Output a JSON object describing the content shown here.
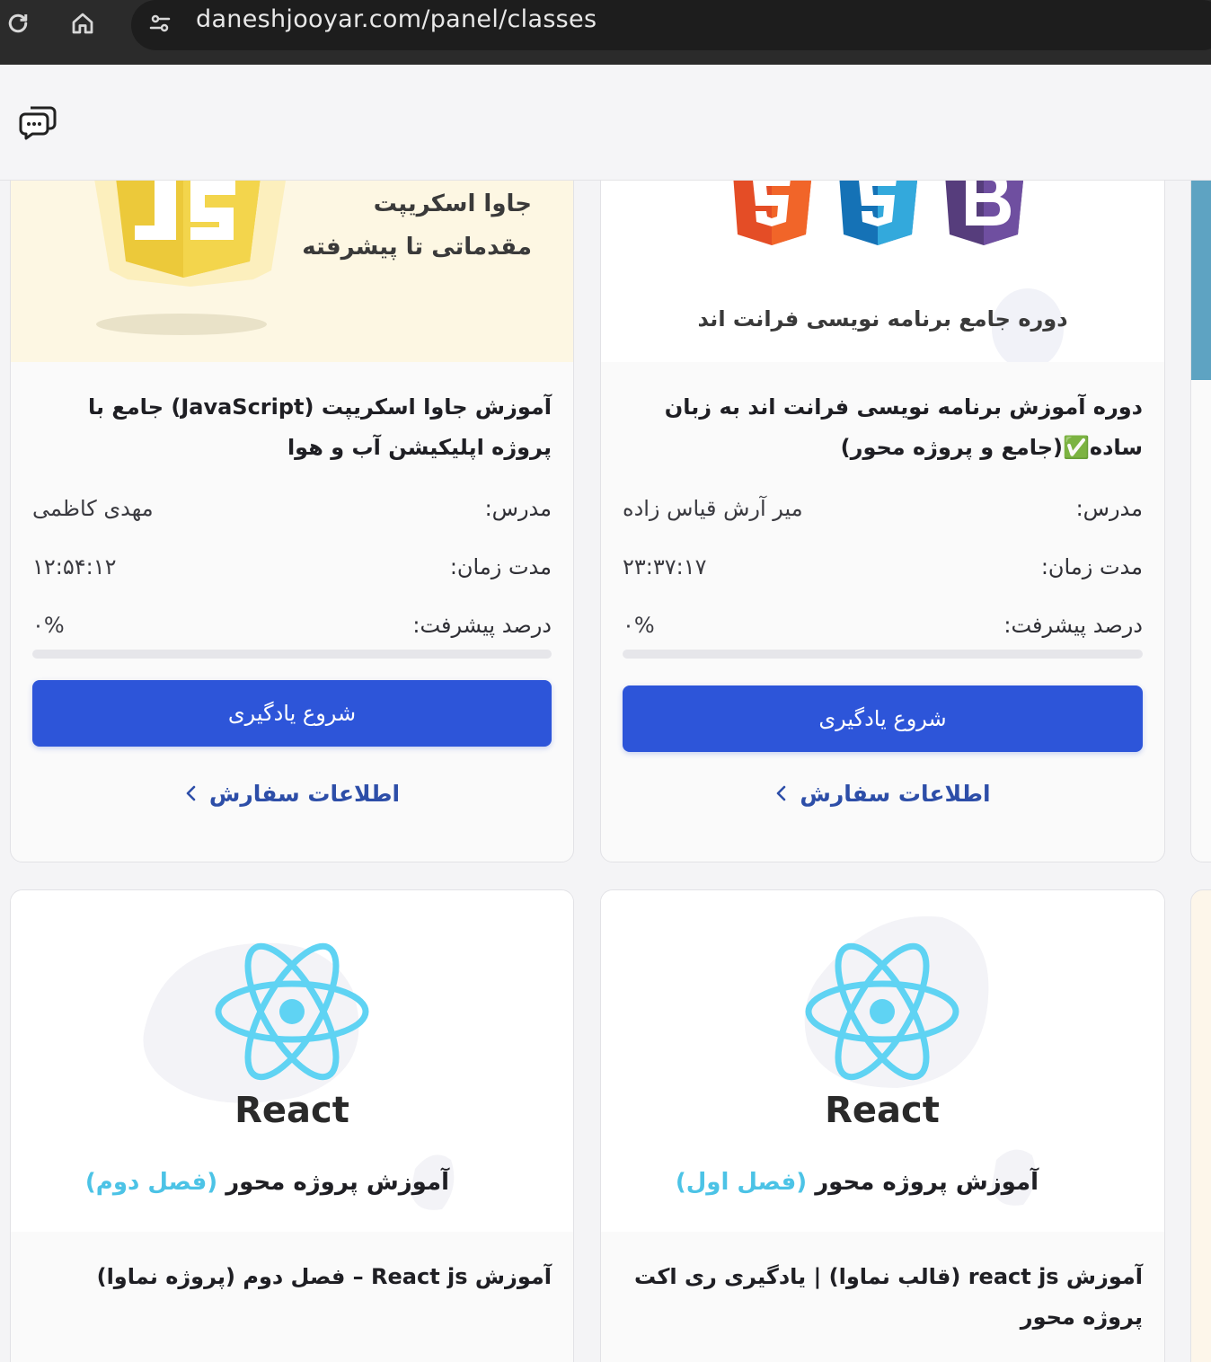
{
  "browser": {
    "url": "daneshjooyar.com/panel/classes"
  },
  "cards": [
    {
      "thumb_line1": "جاوا اسکریپت",
      "thumb_line2": "مقدماتی تا پیشرفته",
      "title": "آموزش جاوا اسکریپت (JavaScript) جامع با پروژه اپلیکیشن آب و هوا",
      "teacher_label": "مدرس:",
      "teacher": "مهدی کاظمی",
      "duration_label": "مدت زمان:",
      "duration": "۱۲:۵۴:۱۲",
      "progress_label": "درصد پیشرفت:",
      "progress_text": "۰%",
      "progress_value": 0,
      "cta": "شروع یادگیری",
      "order_link": "اطلاعات سفارش"
    },
    {
      "thumb_line1": "دوره جامع برنامه نویسی فرانت اند",
      "title": "دوره آموزش برنامه نویسی فرانت اند به زبان ساده✅(جامع و پروژه محور)",
      "teacher_label": "مدرس:",
      "teacher": "میر آرش قیاس زاده",
      "duration_label": "مدت زمان:",
      "duration": "۲۳:۳۷:۱۷",
      "progress_label": "درصد پیشرفت:",
      "progress_text": "۰%",
      "progress_value": 0,
      "cta": "شروع یادگیری",
      "order_link": "اطلاعات سفارش"
    },
    {
      "react_word": "React",
      "react_sub_main": "آموزش پروژه محور ",
      "react_sub_hl": "(فصل دوم)",
      "title": "آموزش React js – فصل دوم (پروژه نماوا)"
    },
    {
      "react_word": "React",
      "react_sub_main": "آموزش پروژه محور ",
      "react_sub_hl": "(فصل اول)",
      "title": "آموزش react js (قالب نماوا) | یادگیری ری اکت پروژه محور"
    }
  ],
  "colors": {
    "primary": "#2d55d9",
    "link": "#2d4ea8",
    "react_cyan": "#61dafb"
  }
}
